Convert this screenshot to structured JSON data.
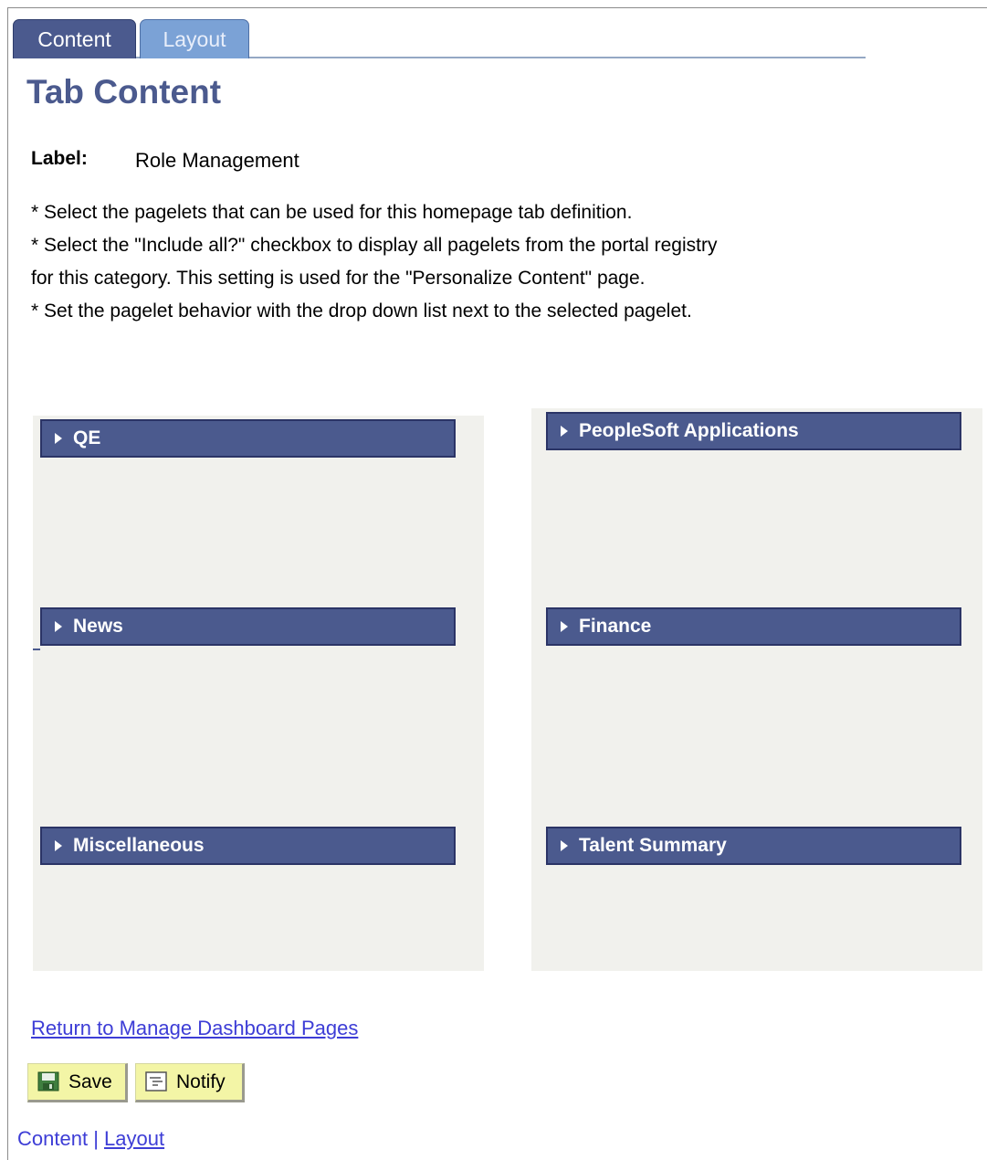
{
  "tabs": [
    {
      "label": "Content",
      "active": true
    },
    {
      "label": "Layout",
      "active": false
    }
  ],
  "page_title": "Tab Content",
  "label_field": {
    "key": "Label:",
    "value": "Role Management"
  },
  "instructions": [
    "* Select the pagelets that can be used for this homepage tab definition.",
    "* Select the \"Include all?\" checkbox to display all pagelets from the portal registry",
    "for this category. This setting is used for the \"Personalize Content\" page.",
    "* Set the pagelet behavior with the drop down list next to the selected pagelet."
  ],
  "left_column": [
    "QE",
    "News",
    "Miscellaneous"
  ],
  "right_column": [
    "PeopleSoft Applications",
    "Finance",
    "Talent Summary"
  ],
  "return_link": "Return to Manage Dashboard Pages",
  "buttons": {
    "save": "Save",
    "notify": "Notify"
  },
  "footer_nav": {
    "content": "Content",
    "separator": "|",
    "layout": "Layout"
  },
  "colors": {
    "accent": "#4b5a8e",
    "tab_inactive": "#7ba2d6",
    "panel_bg": "#f1f1ed",
    "button_bg": "#f3f5a6",
    "link": "#3d3dd6"
  }
}
